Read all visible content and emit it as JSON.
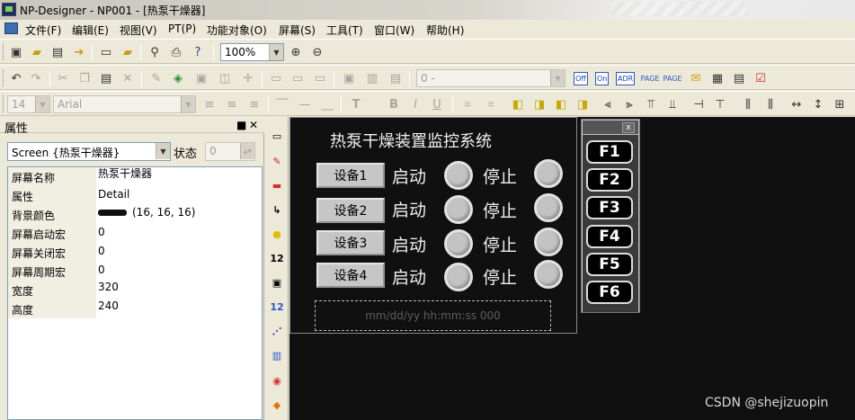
{
  "window": {
    "title": "NP-Designer - NP001 - [热泵干燥器]"
  },
  "menu": {
    "items": [
      "文件(F)",
      "编辑(E)",
      "视图(V)",
      "PT(P)",
      "功能对象(O)",
      "屏幕(S)",
      "工具(T)",
      "窗口(W)",
      "帮助(H)"
    ]
  },
  "toolbar": {
    "zoom": "100%",
    "object_combo": "0 -",
    "font_size": "14",
    "font_name": "Arial",
    "text_tool": "T",
    "bold": "B",
    "italic": "I",
    "underline": "U",
    "off_label": "Off",
    "on_label": "On",
    "adr_label": "ADR"
  },
  "props": {
    "title": "属性",
    "pin": "■",
    "close": "✕",
    "screen_select": "Screen {热泵干燥器}",
    "state_label": "状态",
    "state_value": "0",
    "rows": [
      {
        "key": "屏幕名称",
        "value": "热泵干燥器"
      },
      {
        "key": "属性",
        "value": "Detail"
      },
      {
        "key": "背景颜色",
        "value": "(16, 16, 16)",
        "color": "#101010"
      },
      {
        "key": "屏幕启动宏",
        "value": "0"
      },
      {
        "key": "屏幕关闭宏",
        "value": "0"
      },
      {
        "key": "屏幕周期宏",
        "value": "0"
      },
      {
        "key": "宽度",
        "value": "320"
      },
      {
        "key": "高度",
        "value": "240"
      }
    ]
  },
  "vstrip": {
    "num1": "12",
    "num2": "12"
  },
  "hmi": {
    "title": "热泵干燥装置监控系统",
    "devices": [
      {
        "button": "设备1",
        "start": "启动",
        "stop": "停止"
      },
      {
        "button": "设备2",
        "start": "启动",
        "stop": "停止"
      },
      {
        "button": "设备3",
        "start": "启动",
        "stop": "停止"
      },
      {
        "button": "设备4",
        "start": "启动",
        "stop": "停止"
      }
    ],
    "time_placeholder": "mm/dd/yy hh:mm:ss  000",
    "lamp_color": "#c3c3c3",
    "background": "#101010"
  },
  "fkeys": {
    "close": "x",
    "keys": [
      "F1",
      "F2",
      "F3",
      "F4",
      "F5",
      "F6"
    ]
  },
  "watermark": "CSDN @shejizuopin"
}
